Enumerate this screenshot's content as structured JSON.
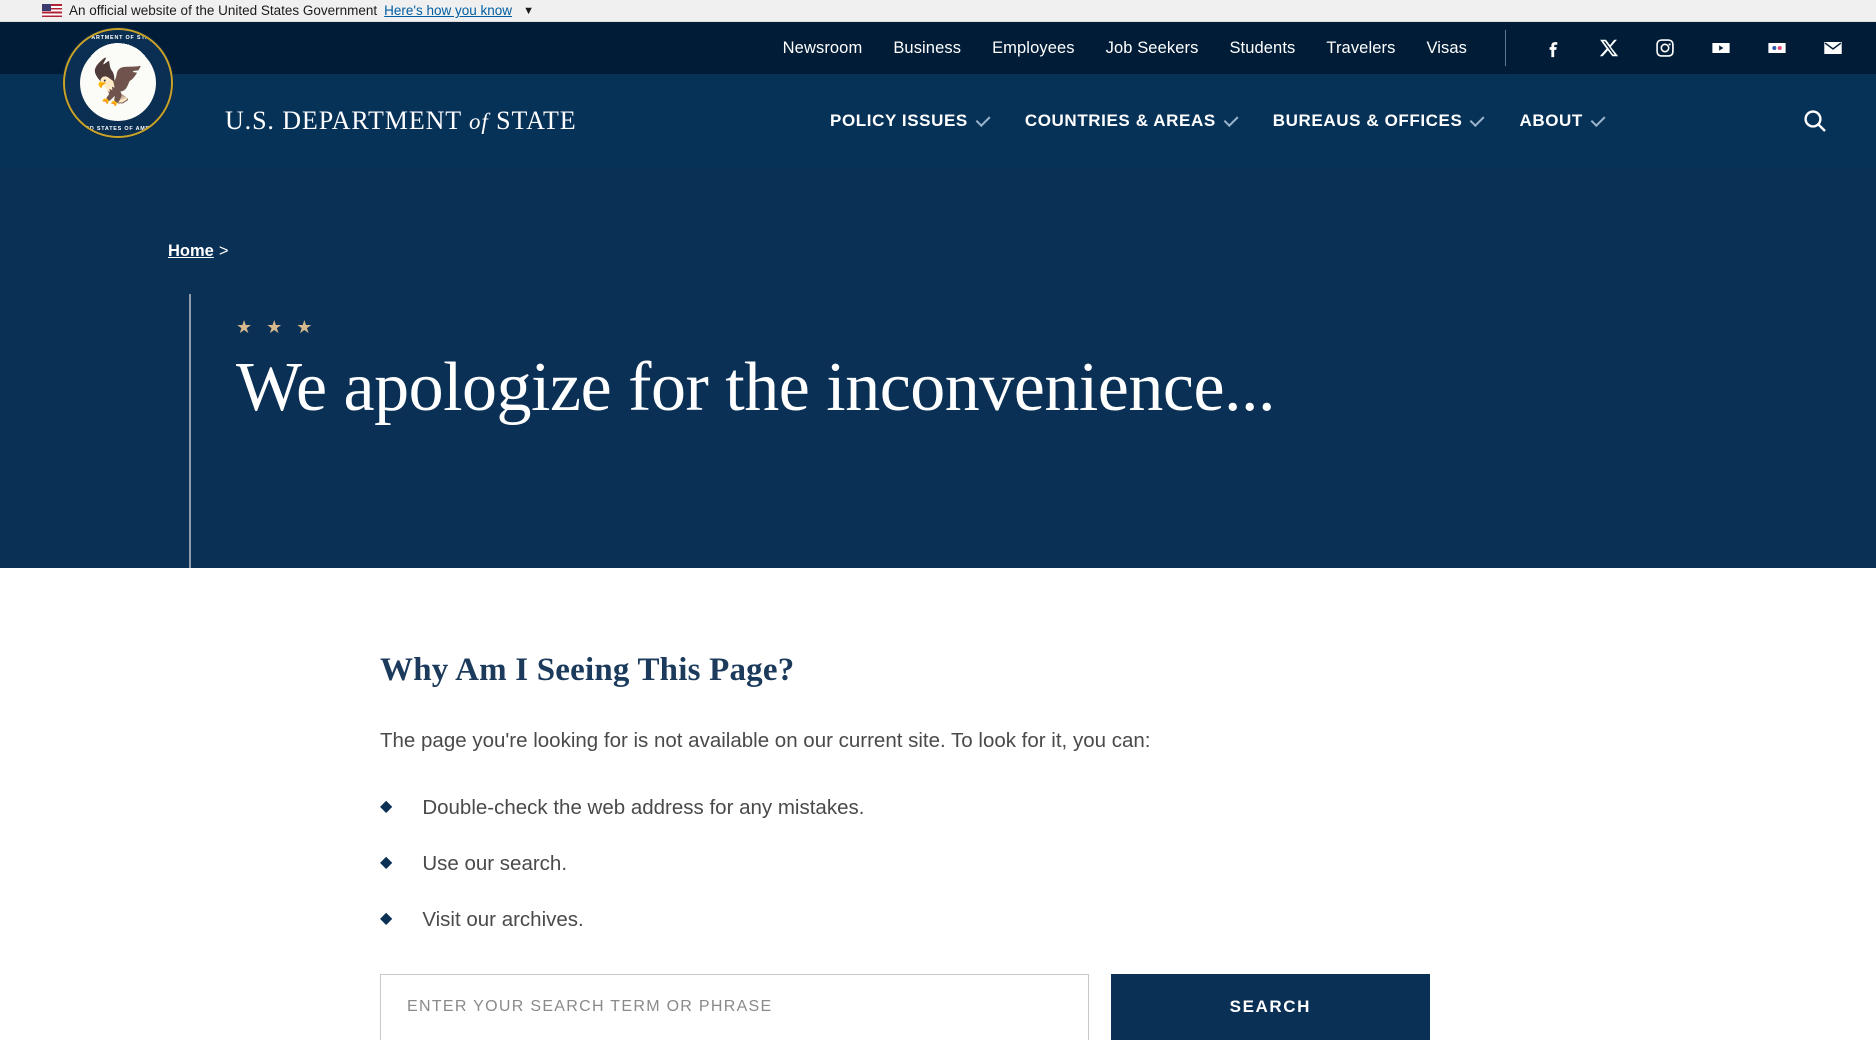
{
  "colors": {
    "gov_banner_bg": "#f0f0f0",
    "utility_bar_bg": "#001c36",
    "masthead_bg": "#073258",
    "hero_bg": "#0a3055",
    "accent_star": "#d6b98c",
    "link_blue": "#005ea2",
    "button_navy": "#0a3055"
  },
  "gov_banner": {
    "flag_icon": "us-flag-icon",
    "text": "An official website of the United States Government",
    "link_label": "Here's how you know",
    "chevron_icon": "chevron-down-icon"
  },
  "utility_bar": {
    "links": [
      {
        "label": "Newsroom"
      },
      {
        "label": "Business"
      },
      {
        "label": "Employees"
      },
      {
        "label": "Job Seekers"
      },
      {
        "label": "Students"
      },
      {
        "label": "Travelers"
      },
      {
        "label": "Visas"
      }
    ],
    "social": [
      {
        "name": "facebook-icon"
      },
      {
        "name": "x-twitter-icon"
      },
      {
        "name": "instagram-icon"
      },
      {
        "name": "youtube-icon"
      },
      {
        "name": "flickr-icon"
      },
      {
        "name": "email-icon"
      }
    ]
  },
  "masthead": {
    "seal": {
      "icon": "department-of-state-seal-icon",
      "top_text": "DEPARTMENT OF STATE",
      "bottom_text": "UNITED STATES OF AMERICA"
    },
    "wordmark": {
      "part1": "U.S. DEPARTMENT",
      "of": "of",
      "part2": "STATE"
    },
    "nav": [
      {
        "label": "POLICY ISSUES",
        "icon": "chevron-down-icon"
      },
      {
        "label": "COUNTRIES & AREAS",
        "icon": "chevron-down-icon"
      },
      {
        "label": "BUREAUS & OFFICES",
        "icon": "chevron-down-icon"
      },
      {
        "label": "ABOUT",
        "icon": "chevron-down-icon"
      }
    ],
    "search_icon": "search-icon"
  },
  "hero": {
    "breadcrumb": {
      "home_label": "Home",
      "separator": ">"
    },
    "stars": [
      "★",
      "★",
      "★"
    ],
    "title": "We apologize for the inconvenience..."
  },
  "main": {
    "section_title": "Why Am I Seeing This Page?",
    "lede": "The page you're looking for is not available on our current site. To look for it, you can:",
    "reasons": [
      {
        "text": "Double-check the web address for any mistakes."
      },
      {
        "text": "Use our search."
      },
      {
        "text": "Visit our archives."
      }
    ],
    "search": {
      "placeholder": "ENTER YOUR SEARCH TERM OR PHRASE",
      "value": "",
      "button_label": "SEARCH"
    }
  }
}
